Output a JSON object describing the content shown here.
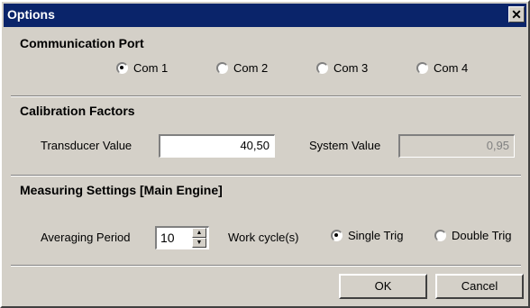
{
  "window": {
    "title": "Options",
    "close_glyph": "✕"
  },
  "communication": {
    "heading": "Communication Port",
    "ports": [
      {
        "label": "Com 1",
        "checked": true
      },
      {
        "label": "Com 2",
        "checked": false
      },
      {
        "label": "Com 3",
        "checked": false
      },
      {
        "label": "Com 4",
        "checked": false
      }
    ]
  },
  "calibration": {
    "heading": "Calibration Factors",
    "transducer_label": "Transducer Value",
    "transducer_value": "40,50",
    "system_label": "System Value",
    "system_value": "0,95"
  },
  "measuring": {
    "heading": "Measuring Settings  [Main Engine]",
    "averaging_label": "Averaging Period",
    "averaging_value": "10",
    "work_cycle_label": "Work cycle(s)",
    "single_trig_label": "Single Trig",
    "single_trig_checked": true,
    "double_trig_label": "Double Trig",
    "double_trig_checked": false
  },
  "buttons": {
    "ok": "OK",
    "cancel": "Cancel"
  },
  "colors": {
    "titlebar": "#0a246a",
    "face": "#d4d0c8"
  }
}
